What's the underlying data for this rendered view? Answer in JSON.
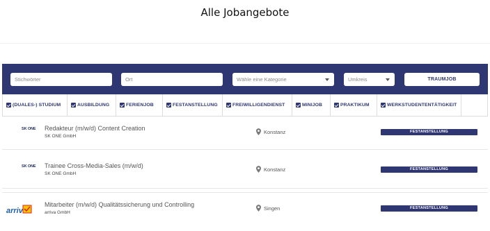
{
  "page": {
    "title": "Alle Jobangebote"
  },
  "search": {
    "keywords_placeholder": "Stichwörter",
    "location_placeholder": "Ort",
    "category_placeholder": "Wähle eine Kategorie",
    "radius_placeholder": "Umkreis",
    "submit_label": "TRAUMJOB"
  },
  "filters": [
    {
      "label": "(DUALES-) STUDIUM",
      "checked": true
    },
    {
      "label": "AUSBILDUNG",
      "checked": true
    },
    {
      "label": "FERIENJOB",
      "checked": true
    },
    {
      "label": "FESTANSTELLUNG",
      "checked": true
    },
    {
      "label": "FREIWILLIGENDIENST",
      "checked": true
    },
    {
      "label": "MINIJOB",
      "checked": true
    },
    {
      "label": "PRAKTIKUM",
      "checked": true
    },
    {
      "label": "WERKSTUDENTENTÄTIGKEIT",
      "checked": true
    }
  ],
  "jobs": [
    {
      "logo_text": "SK ONE",
      "title": "Redakteur (m/w/d) Content Creation",
      "company": "SK ONE GmbH",
      "location": "Konstanz",
      "type": "FESTANSTELLUNG"
    },
    {
      "logo_text": "SK ONE",
      "title": "Trainee Cross-Media-Sales (m/w/d)",
      "company": "SK ONE GmbH",
      "location": "Konstanz",
      "type": "FESTANSTELLUNG"
    },
    {
      "logo_text": "arriva",
      "title": "Mitarbeiter (m/w/d) Qualitätssicherung und Controlling",
      "company": "arriva GmbH",
      "location": "Singen",
      "type": "FESTANSTELLUNG"
    }
  ],
  "colors": {
    "brand_navy": "#2f3772",
    "arriva_red": "#e2231a",
    "arriva_yellow": "#f5c400",
    "arriva_blue": "#1f5fa8"
  }
}
